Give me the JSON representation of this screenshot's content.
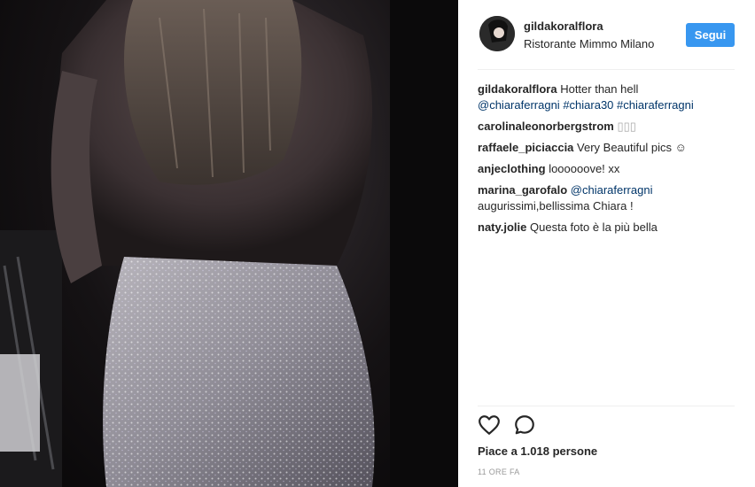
{
  "header": {
    "username": "gildakoralflora",
    "location": "Ristorante Mimmo Milano",
    "follow_label": "Segui"
  },
  "caption": {
    "username": "gildakoralflora",
    "text": "Hotter than hell",
    "tags": [
      "@chiaraferragni",
      "#chiara30",
      "#chiaraferragni"
    ]
  },
  "comments": [
    {
      "username": "carolinaleonorbergstrom",
      "text": "▯▯▯"
    },
    {
      "username": "raffaele_piciaccia",
      "text": "Very Beautiful pics ☺"
    },
    {
      "username": "anjeclothing",
      "text": "loooooove! xx"
    },
    {
      "username": "marina_garofalo",
      "mention": "@chiaraferragni",
      "text": "augurissimi,bellissima Chiara !"
    },
    {
      "username": "naty.jolie",
      "text": "Questa foto è la più bella"
    }
  ],
  "actions": {
    "like_icon": "heart-icon",
    "comment_icon": "comment-icon"
  },
  "likes_text": "Piace a 1.018 persone",
  "time_text": "11 ORE FA",
  "colors": {
    "follow_button": "#3897f0",
    "link": "#003569",
    "muted": "#999999"
  }
}
